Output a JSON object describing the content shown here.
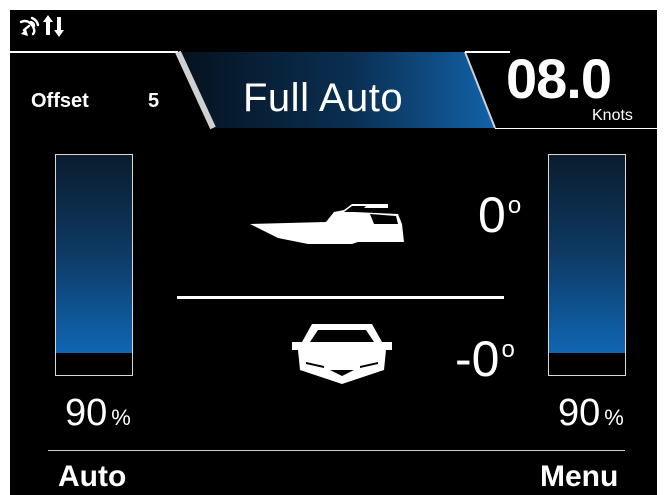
{
  "status": {
    "gps_icon": "satellite-dish-icon",
    "data_icon": "up-down-arrows-icon"
  },
  "header": {
    "offset_label": "Offset",
    "offset_value": "5",
    "mode": "Full Auto",
    "speed": "08.0",
    "speed_unit": "Knots"
  },
  "trim_tabs": {
    "left": {
      "percent": "90",
      "unit": "%",
      "level": 0.9
    },
    "right": {
      "percent": "90",
      "unit": "%",
      "level": 0.9
    }
  },
  "attitude": {
    "pitch": "0",
    "roll": "-0",
    "degree_symbol": "o"
  },
  "softkeys": {
    "left": "Auto",
    "right": "Menu"
  },
  "colors": {
    "background": "#000000",
    "bar_top": "#0b1c2d",
    "bar_bottom": "#1070c4",
    "banner_dark": "#07182a",
    "banner_light": "#0f4f8a",
    "text": "#ffffff"
  }
}
